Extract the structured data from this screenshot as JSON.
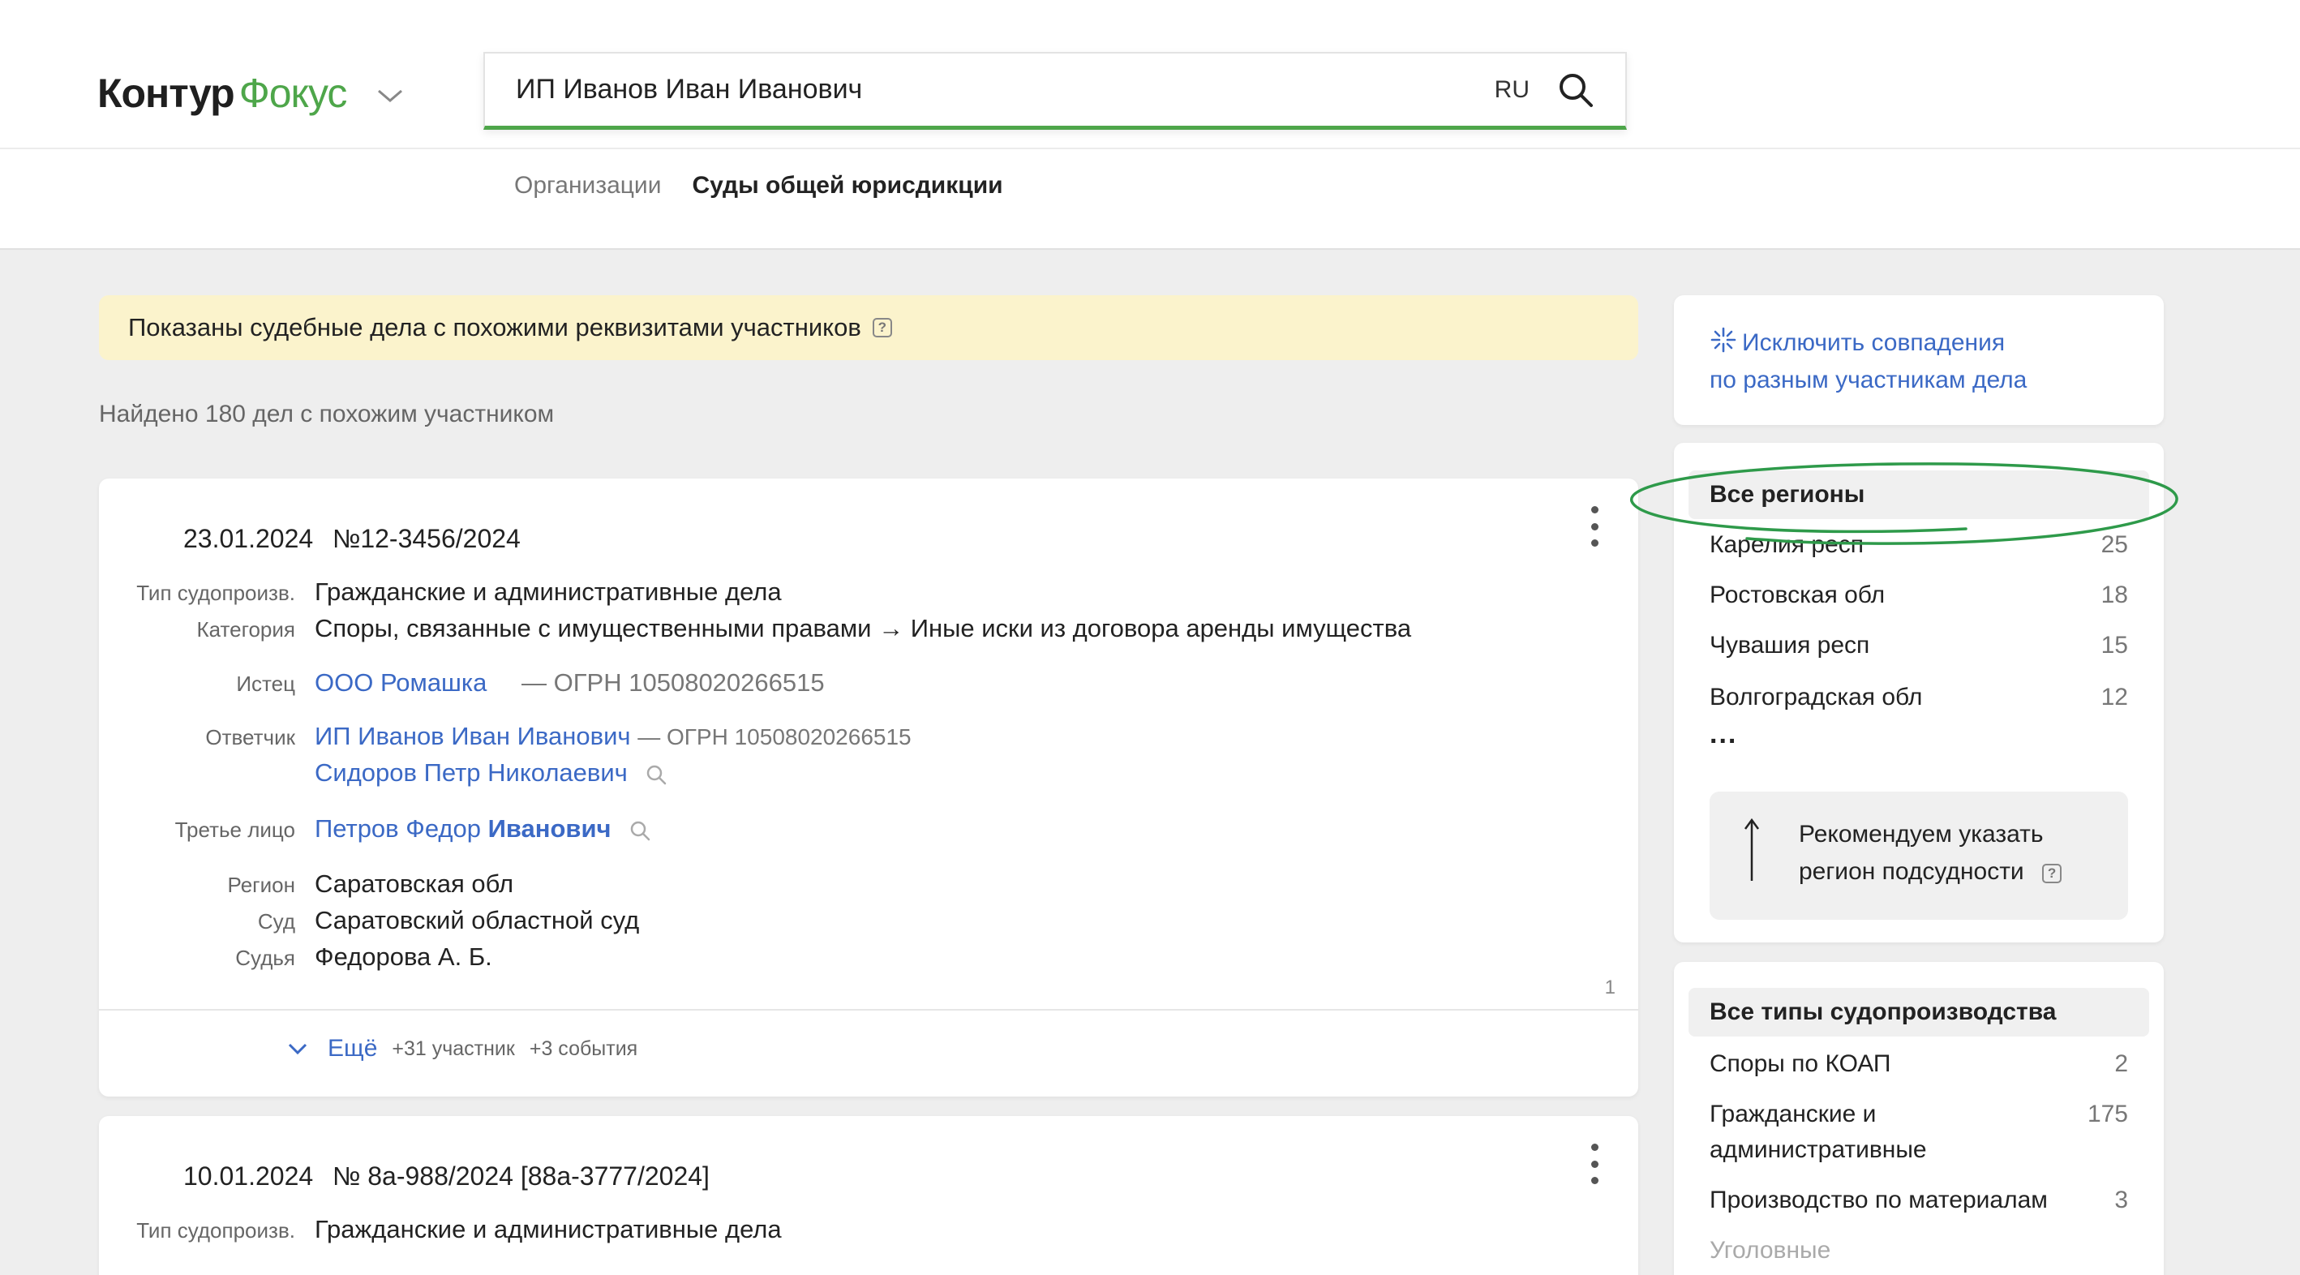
{
  "header": {
    "logo_part1": "Контур",
    "logo_part2": "Фокус",
    "search_value": "ИП Иванов Иван Иванович",
    "lang": "RU",
    "tabs": [
      {
        "label": "Организации",
        "active": false
      },
      {
        "label": "Суды общей юрисдикции",
        "active": true
      }
    ]
  },
  "notice": {
    "text": "Показаны судебные дела с похожими реквизитами участников"
  },
  "found_text": "Найдено 180 дел с похожим участником",
  "cases": [
    {
      "date": "23.01.2024",
      "number": "№12-3456/2024",
      "type_label": "Тип судопроизв.",
      "type_value": "Гражданские и административные дела",
      "category_label": "Категория",
      "category_value": "Споры, связанные с имущественными правами → Иные иски из договора аренды имущества",
      "plaintiff_label": "Истец",
      "plaintiff_name": "ООО Ромашка",
      "plaintiff_ogrn": "— ОГРН 10508020266515",
      "defendant_label": "Ответчик",
      "defendant1_name": "ИП Иванов Иван Иванович",
      "defendant1_ogrn": "— ОГРН 10508020266515",
      "defendant2_name": "Сидоров Петр Николаевич",
      "third_label": "Третье лицо",
      "third_name_regular": "Петров Федор ",
      "third_name_bold": "Иванович",
      "region_label": "Регион",
      "region_value": "Саратовская обл",
      "court_label": "Суд",
      "court_value": "Саратовский областной суд",
      "judge_label": "Судья",
      "judge_value": "Федорова А. Б.",
      "page_num": "1",
      "more_label": "Ещё",
      "more_participants": "+31 участник",
      "more_events": "+3 события"
    },
    {
      "date": "10.01.2024",
      "number": "№ 8а-988/2024 [88а-3777/2024]",
      "type_label": "Тип судопроизв.",
      "type_value": "Гражданские и административные дела"
    }
  ],
  "sidebar": {
    "exclude_line1": "Исключить совпадения",
    "exclude_line2": "по разным участникам дела",
    "regions_head": "Все регионы",
    "regions": [
      {
        "name": "Карелия респ",
        "count": "25"
      },
      {
        "name": "Ростовская обл",
        "count": "18"
      },
      {
        "name": "Чувашия респ",
        "count": "15"
      },
      {
        "name": "Волгоградская обл",
        "count": "12"
      }
    ],
    "regions_more": "...",
    "recommend_line1": "Рекомендуем указать",
    "recommend_line2": "регион подсудности",
    "types_head": "Все типы судопроизводства",
    "types": [
      {
        "name": "Споры по КОАП",
        "count": "2"
      },
      {
        "name_line1": "Гражданские и",
        "name_line2": "административные",
        "count": "175"
      },
      {
        "name": "Производство по материалам",
        "count": "3"
      },
      {
        "name": "Уголовные",
        "count": ""
      }
    ]
  },
  "colors": {
    "accent_green": "#4ea64a",
    "link_blue": "#3b69c5",
    "notice_bg": "#fbf3cc",
    "highlight_ellipse": "#2e9a4a"
  }
}
